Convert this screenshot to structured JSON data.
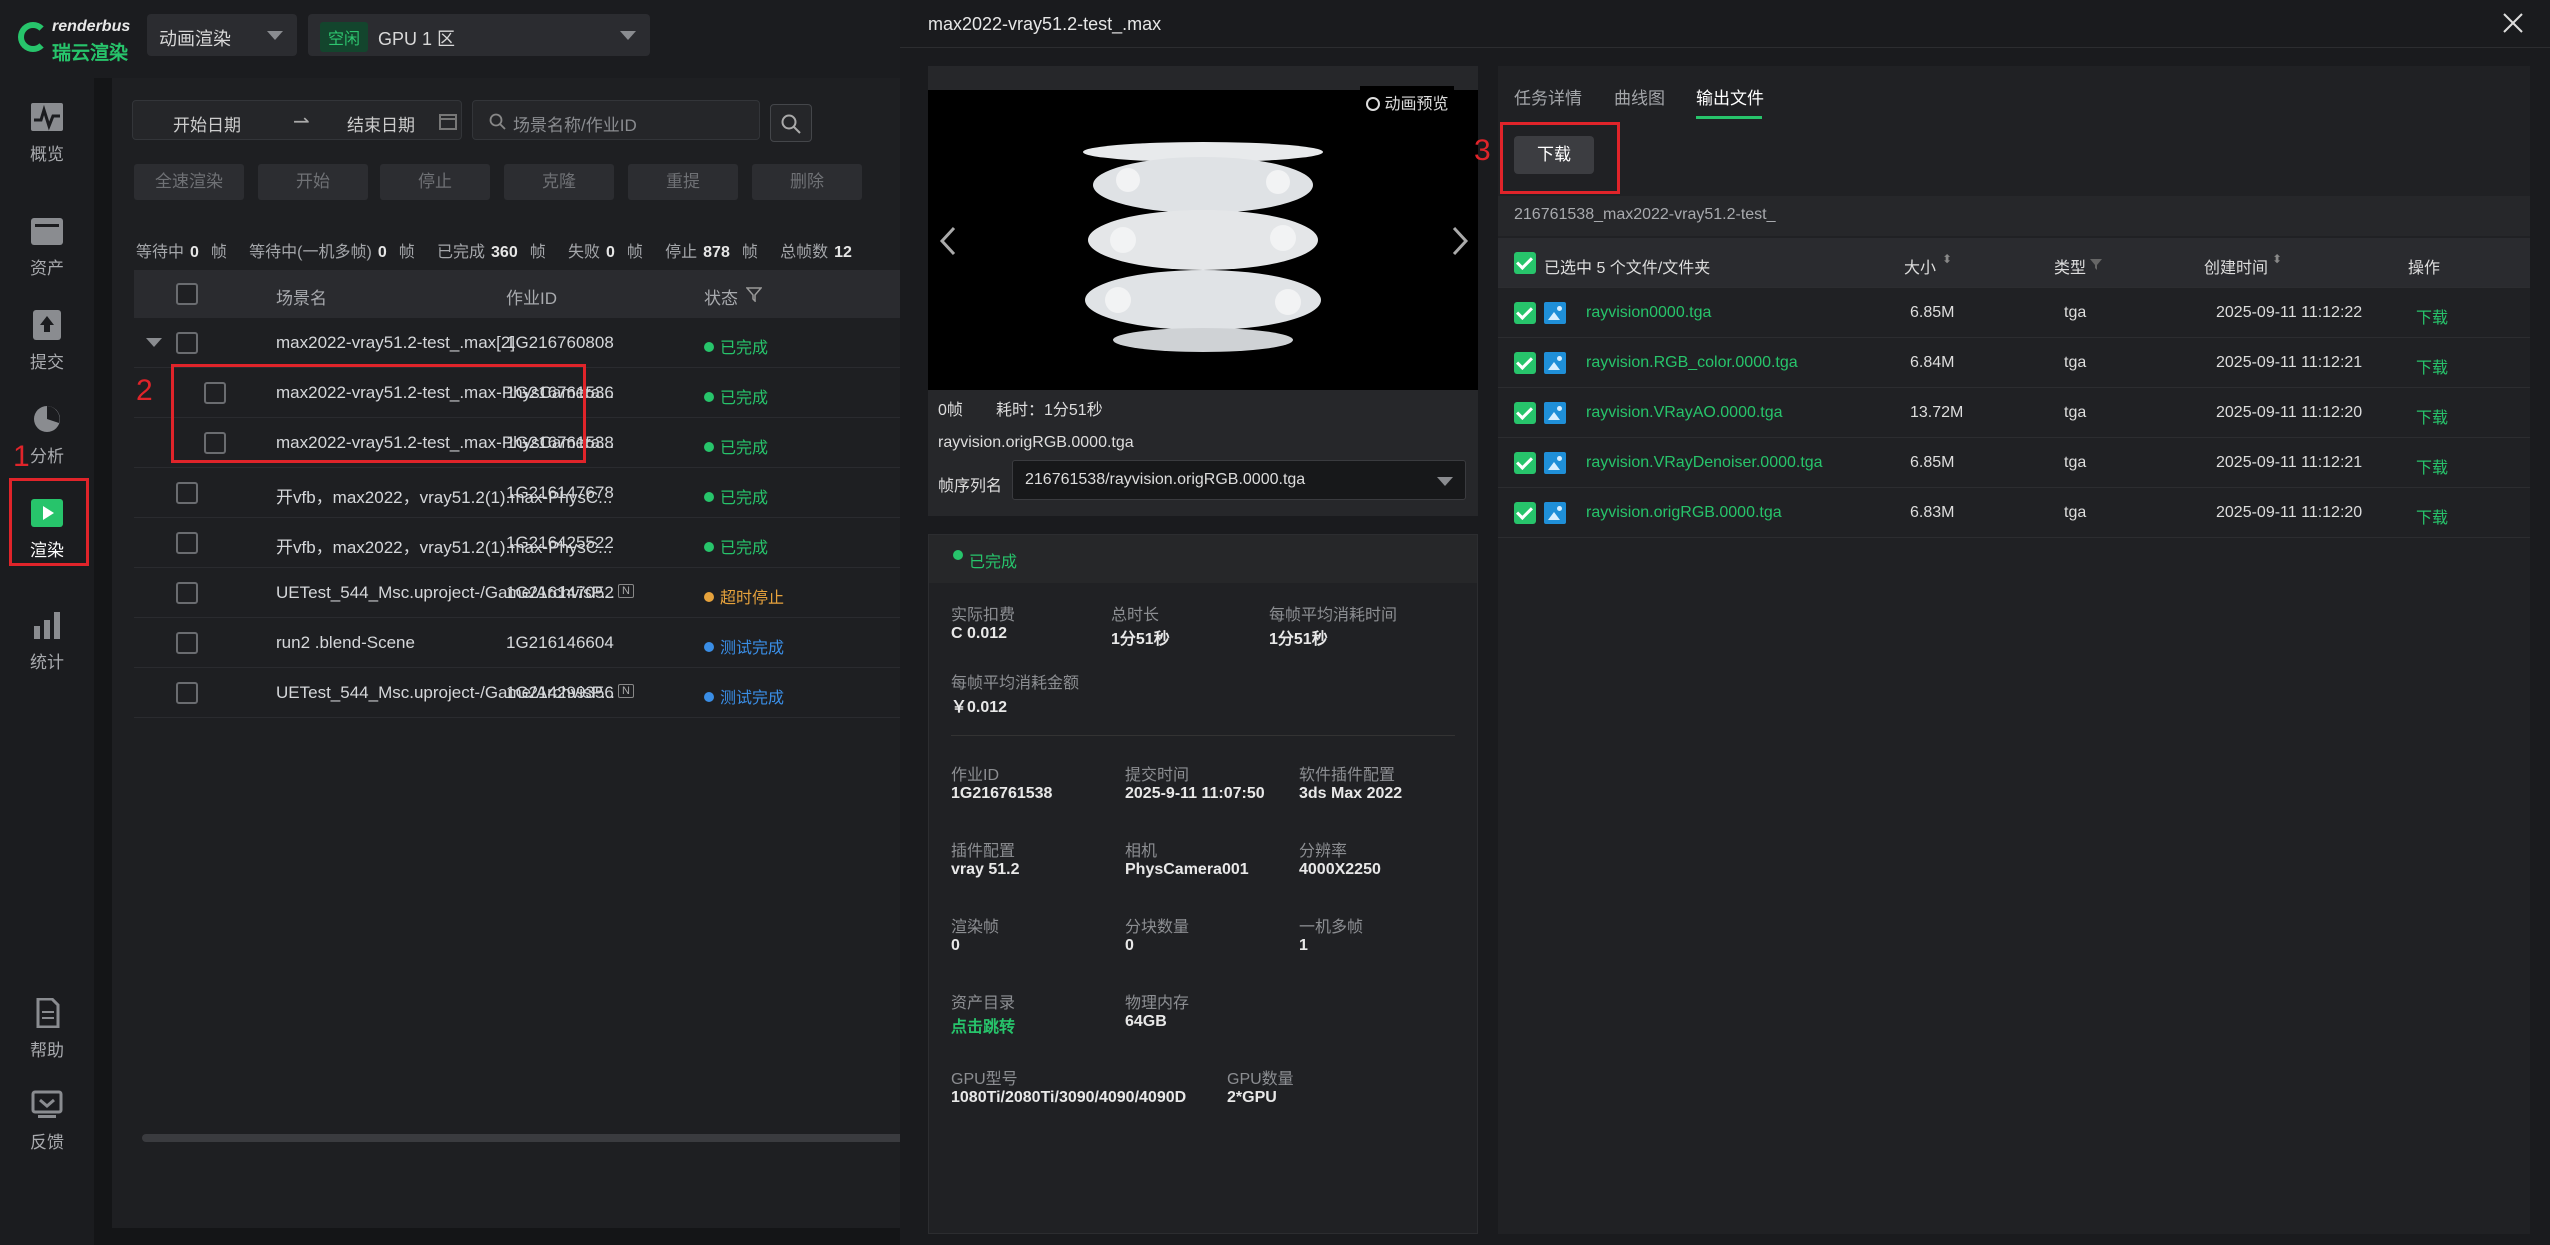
{
  "app": {
    "logo_en": "renderbus",
    "logo_cn": "瑞云渲染"
  },
  "topbar": {
    "render_type": "动画渲染",
    "gpu_badge": "空闲",
    "gpu_zone": "GPU 1 区"
  },
  "sidebar": [
    {
      "label": "概览",
      "icon": "pulse-icon"
    },
    {
      "label": "资产",
      "icon": "folder-icon"
    },
    {
      "label": "提交",
      "icon": "upload-icon"
    },
    {
      "label": "分析",
      "icon": "analysis-icon"
    },
    {
      "label": "渲染",
      "icon": "play-icon"
    },
    {
      "label": "统计",
      "icon": "bar-chart-icon"
    },
    {
      "label": "帮助",
      "icon": "document-icon"
    },
    {
      "label": "反馈",
      "icon": "feedback-icon"
    }
  ],
  "markers": {
    "m1": "1",
    "m2": "2",
    "m3": "3"
  },
  "filters": {
    "start_date": "开始日期",
    "arrow": "⇀",
    "end_date": "结束日期",
    "search_placeholder": "场景名称/作业ID"
  },
  "actions": [
    "全速渲染",
    "开始",
    "停止",
    "克隆",
    "重提",
    "删除"
  ],
  "stats": [
    {
      "label": "等待中",
      "value": "0",
      "unit": "帧"
    },
    {
      "label": "等待中(一机多帧)",
      "value": "0",
      "unit": "帧"
    },
    {
      "label": "已完成",
      "value": "360",
      "unit": "帧"
    },
    {
      "label": "失败",
      "value": "0",
      "unit": "帧"
    },
    {
      "label": "停止",
      "value": "878",
      "unit": "帧"
    },
    {
      "label": "总帧数",
      "value": "12",
      "unit": ""
    }
  ],
  "table": {
    "headers": {
      "name": "场景名",
      "job_id": "作业ID",
      "status": "状态"
    },
    "rows": [
      {
        "name": "max2022-vray51.2-test_.max[2]",
        "id": "1G216760808",
        "status": "已完成",
        "color": "#27c46b"
      },
      {
        "name": "max2022-vray51.2-test_.max-PhysCamera...",
        "id": "1G216761536",
        "status": "已完成",
        "color": "#27c46b"
      },
      {
        "name": "max2022-vray51.2-test_.max-PhysCamera...",
        "id": "1G216761538",
        "status": "已完成",
        "color": "#27c46b"
      },
      {
        "name": "开vfb，max2022，vray51.2(1).max-PhysC...",
        "id": "1G216147678",
        "status": "已完成",
        "color": "#27c46b"
      },
      {
        "name": "开vfb，max2022，vray51.2(1).max-PhysC...",
        "id": "1G216425522",
        "status": "已完成",
        "color": "#27c46b"
      },
      {
        "name": "UETest_544_Msc.uproject-/Game/ArchvisP...",
        "id": "1G216147052",
        "tag": "N",
        "status": "超时停止",
        "color": "#e6a23c"
      },
      {
        "name": "run2 .blend-Scene",
        "id": "1G216146604",
        "status": "测试完成",
        "color": "#3a8ee6"
      },
      {
        "name": "UETest_544_Msc.uproject-/Game/ArchvisP...",
        "id": "1G214299356",
        "tag": "N",
        "status": "测试完成",
        "color": "#3a8ee6"
      }
    ]
  },
  "detail": {
    "title": "max2022-vray51.2-test_.max",
    "preview_label": "动画预览",
    "frame": "0帧",
    "elapsed": "耗时：1分51秒",
    "filename": "rayvision.origRGB.0000.tga",
    "seq_label": "帧序列名",
    "seq_value": "216761538/rayvision.origRGB.0000.tga",
    "status": "已完成",
    "info": [
      {
        "k": "实际扣费",
        "v": "C 0.012"
      },
      {
        "k": "总时长",
        "v": "1分51秒"
      },
      {
        "k": "每帧平均消耗时间",
        "v": "1分51秒"
      },
      {
        "k": "每帧平均消耗金额",
        "v": "￥0.012"
      },
      {
        "k": "作业ID",
        "v": "1G216761538"
      },
      {
        "k": "提交时间",
        "v": "2025-9-11 11:07:50"
      },
      {
        "k": "软件插件配置",
        "v": "3ds Max 2022"
      },
      {
        "k": "插件配置",
        "v": "vray 51.2"
      },
      {
        "k": "相机",
        "v": "PhysCamera001"
      },
      {
        "k": "分辨率",
        "v": "4000X2250"
      },
      {
        "k": "渲染帧",
        "v": "0"
      },
      {
        "k": "分块数量",
        "v": "0"
      },
      {
        "k": "一机多帧",
        "v": "1"
      },
      {
        "k": "资产目录",
        "v": "点击跳转"
      },
      {
        "k": "物理内存",
        "v": "64GB"
      },
      {
        "k": "GPU型号",
        "v": "1080Ti/2080Ti/3090/4090/4090D"
      },
      {
        "k": "GPU数量",
        "v": "2*GPU"
      }
    ]
  },
  "output": {
    "tabs": [
      "任务详情",
      "曲线图",
      "输出文件"
    ],
    "download_btn": "下载",
    "path": "216761538_max2022-vray51.2-test_",
    "header": {
      "selected": "已选中 5 个文件/文件夹",
      "size": "大小",
      "type": "类型",
      "created": "创建时间",
      "op": "操作"
    },
    "files": [
      {
        "name": "rayvision0000.tga",
        "size": "6.85M",
        "type": "tga",
        "time": "2025-09-11 11:12:22",
        "op": "下载"
      },
      {
        "name": "rayvision.RGB_color.0000.tga",
        "size": "6.84M",
        "type": "tga",
        "time": "2025-09-11 11:12:21",
        "op": "下载"
      },
      {
        "name": "rayvision.VRayAO.0000.tga",
        "size": "13.72M",
        "type": "tga",
        "time": "2025-09-11 11:12:20",
        "op": "下载"
      },
      {
        "name": "rayvision.VRayDenoiser.0000.tga",
        "size": "6.85M",
        "type": "tga",
        "time": "2025-09-11 11:12:21",
        "op": "下载"
      },
      {
        "name": "rayvision.origRGB.0000.tga",
        "size": "6.83M",
        "type": "tga",
        "time": "2025-09-11 11:12:20",
        "op": "下载"
      }
    ]
  }
}
